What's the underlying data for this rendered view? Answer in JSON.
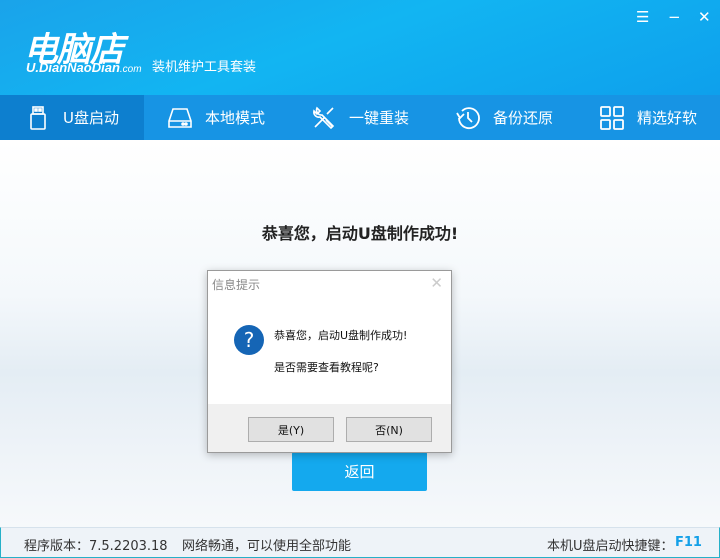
{
  "header": {
    "logo": "电脑店",
    "logo_url": "U.DianNaoDian",
    "logo_domain": ".com",
    "subtitle": "装机维护工具套装"
  },
  "window_controls": {
    "menu": "☰",
    "minimize": "−",
    "close": "✕"
  },
  "nav": {
    "tabs": [
      {
        "label": "U盘启动",
        "icon": "usb-icon"
      },
      {
        "label": "本地模式",
        "icon": "hdd-icon"
      },
      {
        "label": "一键重装",
        "icon": "tools-icon"
      },
      {
        "label": "备份还原",
        "icon": "history-icon"
      },
      {
        "label": "精选好软",
        "icon": "grid-icon"
      }
    ],
    "active": 0
  },
  "main": {
    "success": "恭喜您，启动U盘制作成功!",
    "back_label": "返回"
  },
  "dialog": {
    "title": "信息提示",
    "line1": "恭喜您，启动U盘制作成功!",
    "line2": "是否需要查看教程呢?",
    "yes": "是(Y)",
    "no": "否(N)",
    "close": "✕"
  },
  "status": {
    "version": "程序版本：7.5.2203.18",
    "network": "网络畅通，可以使用全部功能",
    "hotkey_label": "本机U盘启动快捷键：",
    "hotkey": "F11"
  },
  "colors": {
    "accent": "#14a9ee",
    "nav": "#1794e4",
    "active_tab": "#0d7fcf"
  }
}
